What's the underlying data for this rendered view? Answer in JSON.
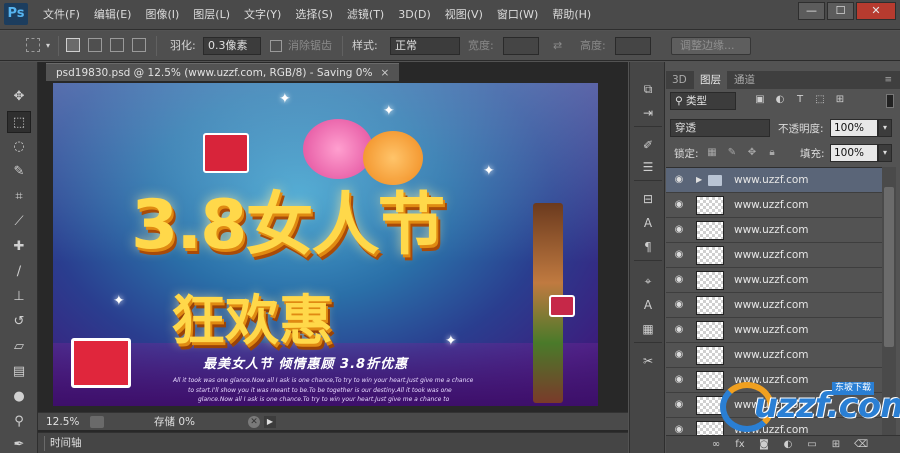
{
  "app": {
    "logo": "Ps"
  },
  "menu": [
    "文件(F)",
    "编辑(E)",
    "图像(I)",
    "图层(L)",
    "文字(Y)",
    "选择(S)",
    "滤镜(T)",
    "3D(D)",
    "视图(V)",
    "窗口(W)",
    "帮助(H)"
  ],
  "window_controls": {
    "minimize": "—",
    "maximize": "☐",
    "close": "✕"
  },
  "options": {
    "feather_label": "羽化:",
    "feather_value": "0.3像素",
    "antialias_label": "消除锯齿",
    "style_label": "样式:",
    "style_value": "正常",
    "width_label": "宽度:",
    "height_label": "高度:",
    "refine_edge": "调整边缘..."
  },
  "document": {
    "tab_title": "psd19830.psd @ 12.5% (www.uzzf.com, RGB/8) - Saving 0%",
    "tab_close": "×",
    "zoom": "12.5%",
    "status": "存储 0%",
    "timeline_tab": "时间轴"
  },
  "canvas": {
    "headline": "3.8女人节",
    "subhead": "狂欢惠",
    "slogan": "最美女人节  倾情惠顾  3.8折优惠",
    "body_line1": "All it took was one glance.Now all I ask is one chance,To try to win your heart.Just give me a chance",
    "body_line2": "to start.I'll show you it was meant to be.To be together is our destiny.All it took was one",
    "body_line3": "glance.Now all I ask is one chance.To try to win your heart.Just give me a chance to"
  },
  "layers_panel": {
    "tabs": [
      "3D",
      "图层",
      "通道"
    ],
    "active_tab": 1,
    "filter_value": "类型",
    "blend_mode": "穿透",
    "opacity_label": "不透明度:",
    "opacity_value": "100%",
    "lock_label": "锁定:",
    "fill_label": "填充:",
    "fill_value": "100%",
    "layers": [
      {
        "name": "www.uzzf.com",
        "type": "group"
      },
      {
        "name": "www.uzzf.com",
        "type": "layer"
      },
      {
        "name": "www.uzzf.com",
        "type": "layer"
      },
      {
        "name": "www.uzzf.com",
        "type": "layer"
      },
      {
        "name": "www.uzzf.com",
        "type": "layer"
      },
      {
        "name": "www.uzzf.com",
        "type": "layer"
      },
      {
        "name": "www.uzzf.com",
        "type": "layer"
      },
      {
        "name": "www.uzzf.com",
        "type": "layer"
      },
      {
        "name": "www.uzzf.com",
        "type": "layer"
      },
      {
        "name": "www.uzzf.com",
        "type": "layer"
      },
      {
        "name": "www.uzzf.com",
        "type": "layer"
      }
    ]
  },
  "watermark": {
    "text": "uzzf.com",
    "tag": "东坡下载"
  },
  "colors": {
    "menubar": "#4a4a4a",
    "panel": "#535353",
    "canvas_bg": "#282828",
    "accent_headline": "#ffd84a",
    "group_row": "#5a6578"
  }
}
